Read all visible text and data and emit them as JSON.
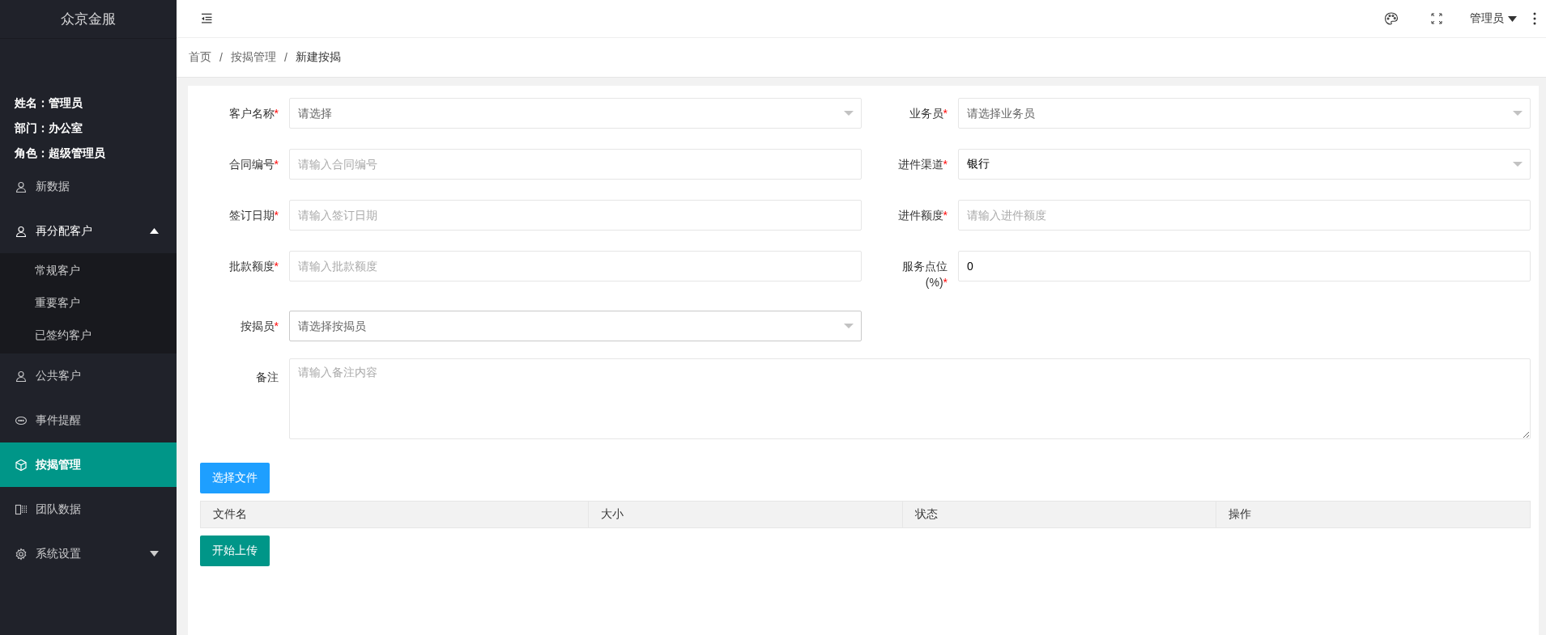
{
  "sidebar": {
    "logo": "众京金服",
    "user_info": [
      "姓名：管理员",
      "部门：办公室",
      "角色：超级管理员"
    ],
    "menu": [
      {
        "label": "新数据",
        "selected": false
      },
      {
        "label": "再分配客户",
        "selected": false,
        "expanded": true,
        "children": [
          {
            "label": "常规客户",
            "selected": false
          },
          {
            "label": "重要客户",
            "selected": false
          },
          {
            "label": "已签约客户",
            "selected": false
          }
        ]
      },
      {
        "label": "公共客户",
        "selected": false
      },
      {
        "label": "事件提醒",
        "selected": false
      },
      {
        "label": "按揭管理",
        "selected": true
      },
      {
        "label": "团队数据",
        "selected": false
      },
      {
        "label": "系统设置",
        "selected": false,
        "expanded": false
      }
    ]
  },
  "topbar": {
    "user": "管理员"
  },
  "breadcrumb": {
    "separator": "/",
    "items": [
      {
        "label": "首页",
        "current": false
      },
      {
        "label": "按揭管理",
        "current": false
      },
      {
        "label": "新建按揭",
        "current": true
      }
    ]
  },
  "form": {
    "required_mark": "*",
    "fields": [
      {
        "label": "客户名称",
        "kind": "select",
        "required": true,
        "placeholder": "请选择"
      },
      {
        "label": "业务员",
        "kind": "select",
        "required": true,
        "placeholder": "请选择业务员"
      },
      {
        "label": "合同编号",
        "kind": "input",
        "required": true,
        "placeholder": "请输入合同编号"
      },
      {
        "label": "进件渠道",
        "kind": "select",
        "required": true,
        "value": "银行"
      },
      {
        "label": "签订日期",
        "kind": "input",
        "required": true,
        "placeholder": "请输入签订日期"
      },
      {
        "label": "进件额度",
        "kind": "input",
        "required": true,
        "placeholder": "请输入进件额度"
      },
      {
        "label": "批款额度",
        "kind": "input",
        "required": true,
        "placeholder": "请输入批款额度"
      },
      {
        "label": "服务点位(%)",
        "kind": "input",
        "required": true,
        "value": "0"
      },
      {
        "label": "按揭员",
        "kind": "select",
        "required": true,
        "placeholder": "请选择按揭员"
      },
      {
        "label": "备注",
        "kind": "textarea",
        "required": false,
        "placeholder": "请输入备注内容"
      }
    ]
  },
  "upload": {
    "choose_button": "选择文件",
    "table": {
      "columns": [
        "文件名",
        "大小",
        "状态",
        "操作"
      ]
    },
    "start_button": "开始上传"
  }
}
